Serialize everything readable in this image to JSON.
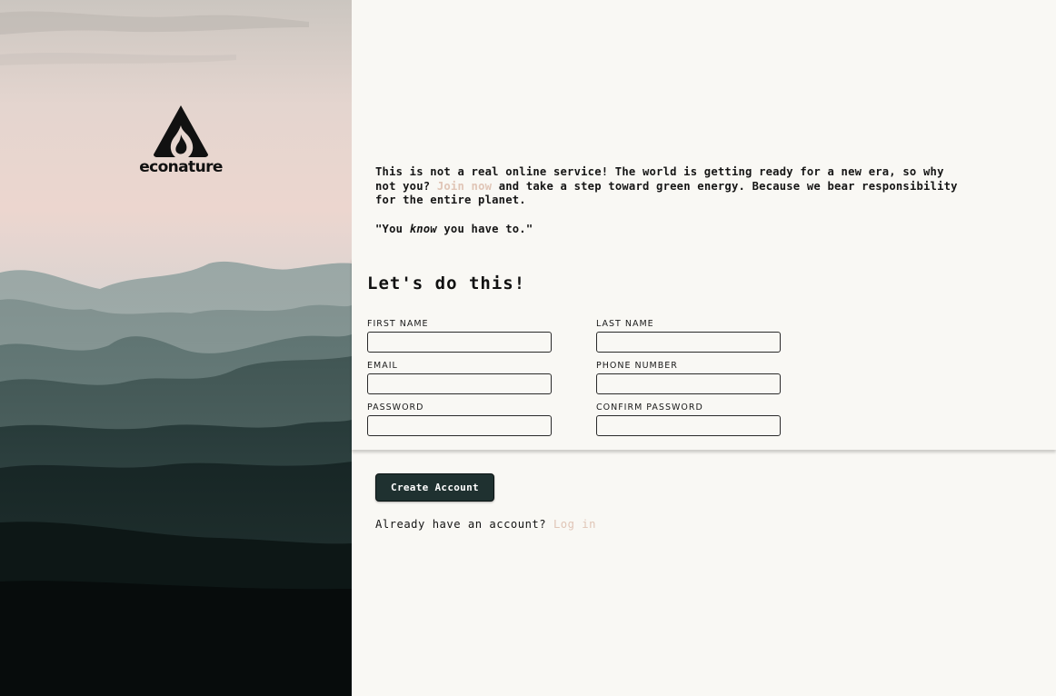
{
  "brand": {
    "name": "econature"
  },
  "intro": {
    "text_before_link": "This is not a real online service! The world is getting ready for a new era, so why not you? ",
    "link": "Join now",
    "text_after_link": " and take a step toward green energy. Because we bear responsibility for the entire planet.",
    "quote_before": "\"You ",
    "quote_emphasis": "know",
    "quote_after": " you have to.\""
  },
  "form": {
    "title": "Let's do this!",
    "fields": {
      "first_name": {
        "label": "FIRST NAME",
        "value": ""
      },
      "last_name": {
        "label": "LAST NAME",
        "value": ""
      },
      "email": {
        "label": "EMAIL",
        "value": ""
      },
      "phone": {
        "label": "PHONE NUMBER",
        "value": ""
      },
      "password": {
        "label": "PASSWORD",
        "value": ""
      },
      "confirm_password": {
        "label": "CONFIRM PASSWORD",
        "value": ""
      }
    },
    "submit_label": "Create Account"
  },
  "login": {
    "prompt": "Already have an account? ",
    "link": "Log in"
  },
  "colors": {
    "accent_link": "#e0c5b6",
    "button_bg": "#1f3130",
    "page_bg": "#f9f8f4"
  },
  "icons": {
    "logo": "flame-mountain-icon"
  }
}
